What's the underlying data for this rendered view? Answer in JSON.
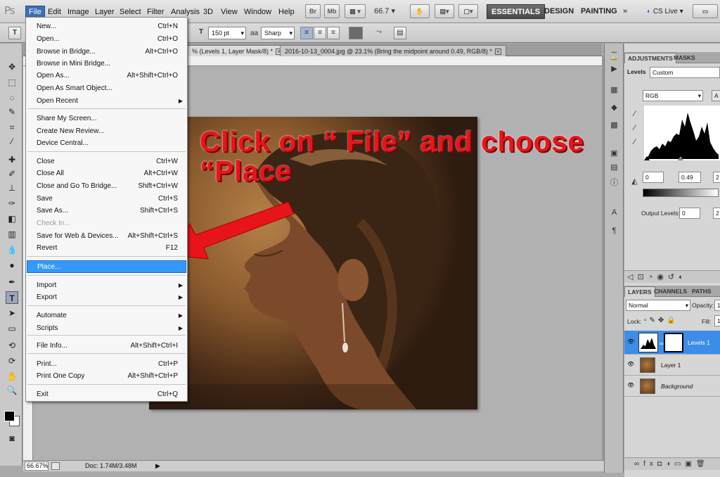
{
  "app": {
    "logo": "Ps",
    "bridge_btn": "Br",
    "minibridge_btn": "Mb",
    "zoom": "66.7",
    "menus": [
      "File",
      "Edit",
      "Image",
      "Layer",
      "Select",
      "Filter",
      "Analysis",
      "3D",
      "View",
      "Window",
      "Help"
    ],
    "workspaces": [
      "ESSENTIALS",
      "DESIGN",
      "PAINTING"
    ],
    "cs_live": "CS Live"
  },
  "options_bar": {
    "font_size": "150 pt",
    "aa_label": "a",
    "antialias": "Sharp"
  },
  "documents": {
    "tab1": "% (Levels 1, Layer Mask/8) *",
    "tab2": "2016-10-13_0004.jpg @ 23.1% (Bring the midpoint around 0.49, RGB/8) *"
  },
  "status": {
    "zoom": "66.67%",
    "doc": "Doc: 1.74M/3.48M"
  },
  "annotation": {
    "line1": "Click on “ File” and choose",
    "line2": "“Place"
  },
  "file_menu": {
    "items": [
      {
        "label": "New...",
        "shortcut": "Ctrl+N"
      },
      {
        "label": "Open...",
        "shortcut": "Ctrl+O"
      },
      {
        "label": "Browse in Bridge...",
        "shortcut": "Alt+Ctrl+O"
      },
      {
        "label": "Browse in Mini Bridge...",
        "shortcut": ""
      },
      {
        "label": "Open As...",
        "shortcut": "Alt+Shift+Ctrl+O"
      },
      {
        "label": "Open As Smart Object...",
        "shortcut": ""
      },
      {
        "label": "Open Recent",
        "shortcut": ""
      },
      {
        "label": "Share My Screen...",
        "shortcut": ""
      },
      {
        "label": "Create New Review...",
        "shortcut": ""
      },
      {
        "label": "Device Central...",
        "shortcut": ""
      },
      {
        "label": "Close",
        "shortcut": "Ctrl+W"
      },
      {
        "label": "Close All",
        "shortcut": "Alt+Ctrl+W"
      },
      {
        "label": "Close and Go To Bridge...",
        "shortcut": "Shift+Ctrl+W"
      },
      {
        "label": "Save",
        "shortcut": "Ctrl+S"
      },
      {
        "label": "Save As...",
        "shortcut": "Shift+Ctrl+S"
      },
      {
        "label": "Check In...",
        "shortcut": ""
      },
      {
        "label": "Save for Web & Devices...",
        "shortcut": "Alt+Shift+Ctrl+S"
      },
      {
        "label": "Revert",
        "shortcut": "F12"
      },
      {
        "label": "Place...",
        "shortcut": ""
      },
      {
        "label": "Import",
        "shortcut": ""
      },
      {
        "label": "Export",
        "shortcut": ""
      },
      {
        "label": "Automate",
        "shortcut": ""
      },
      {
        "label": "Scripts",
        "shortcut": ""
      },
      {
        "label": "File Info...",
        "shortcut": "Alt+Shift+Ctrl+I"
      },
      {
        "label": "Print...",
        "shortcut": "Ctrl+P"
      },
      {
        "label": "Print One Copy",
        "shortcut": "Alt+Shift+Ctrl+P"
      },
      {
        "label": "Exit",
        "shortcut": "Ctrl+Q"
      }
    ]
  },
  "adjustments_panel": {
    "tabs": [
      "ADJUSTMENTS",
      "MASKS"
    ],
    "preset_label": "Levels",
    "preset_value": "Custom",
    "channel": "RGB",
    "auto_btn": "A",
    "input_black": "0",
    "input_mid": "0.49",
    "input_white": "2",
    "output_label": "Output Levels:",
    "output_black": "0",
    "output_white": "2"
  },
  "layers_panel": {
    "tabs": [
      "LAYERS",
      "CHANNELS",
      "PATHS"
    ],
    "blend_mode": "Normal",
    "opacity_label": "Opacity:",
    "opacity_value": "1",
    "lock_label": "Lock:",
    "fill_label": "Fill:",
    "fill_value": "1",
    "layers": [
      "Levels 1",
      "Layer 1",
      "Background"
    ]
  }
}
